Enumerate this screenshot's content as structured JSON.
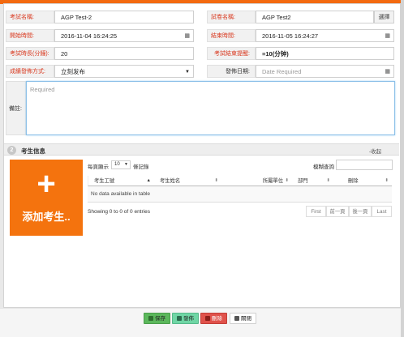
{
  "form": {
    "exam_name_label": "考試名稱:",
    "exam_name_value": "AGP Test-2",
    "paper_name_label": "試卷名稱:",
    "paper_name_value": "AGP Test2",
    "pick_label": "選擇",
    "start_time_label": "開始時間:",
    "start_time_value": "2016-11-04 16:24:25",
    "end_time_label": "結束時間:",
    "end_time_value": "2016-11-05 16:24:27",
    "duration_label": "考試時長(分鐘):",
    "duration_value": "20",
    "end_reminder_label": "考試結束提醒:",
    "end_reminder_value": "10(分钟)",
    "publish_mode_label": "成績發佈方式:",
    "publish_mode_value": "立刻发布",
    "publish_date_label": "發佈日期:",
    "publish_date_placeholder": "Date Required",
    "remark_label": "備註:",
    "remark_placeholder": "Required"
  },
  "section": {
    "number": "2",
    "title": "考生信息",
    "collapse_label": "-收起"
  },
  "add_candidate": {
    "plus": "+",
    "label": "添加考生.."
  },
  "table": {
    "per_page_prefix": "每頁顯示",
    "per_page_value": "10",
    "per_page_suffix": "條記錄",
    "search_label": "模糊查詢",
    "columns": [
      "考生工號",
      "考生姓名",
      "所屬單位",
      "部門",
      "刪除"
    ],
    "empty_text": "No data available in table",
    "info": "Showing 0 to 0 of 0 entries",
    "pagination": [
      "First",
      "前一頁",
      "後一頁",
      "Last"
    ]
  },
  "footer": {
    "save_label": "保存",
    "publish_label": "發佈",
    "delete_label": "刪除",
    "close_label": "關閉"
  },
  "colors": {
    "accent": "#f4730e",
    "label_text": "#d9381e",
    "save_button": "#5cb85c",
    "publish_button": "#6fd6a5",
    "delete_button": "#e0524b"
  },
  "icons": [
    "calendar-icon",
    "chevron-down-icon",
    "sort-icon",
    "save-icon",
    "publish-icon",
    "delete-icon",
    "close-icon"
  ]
}
